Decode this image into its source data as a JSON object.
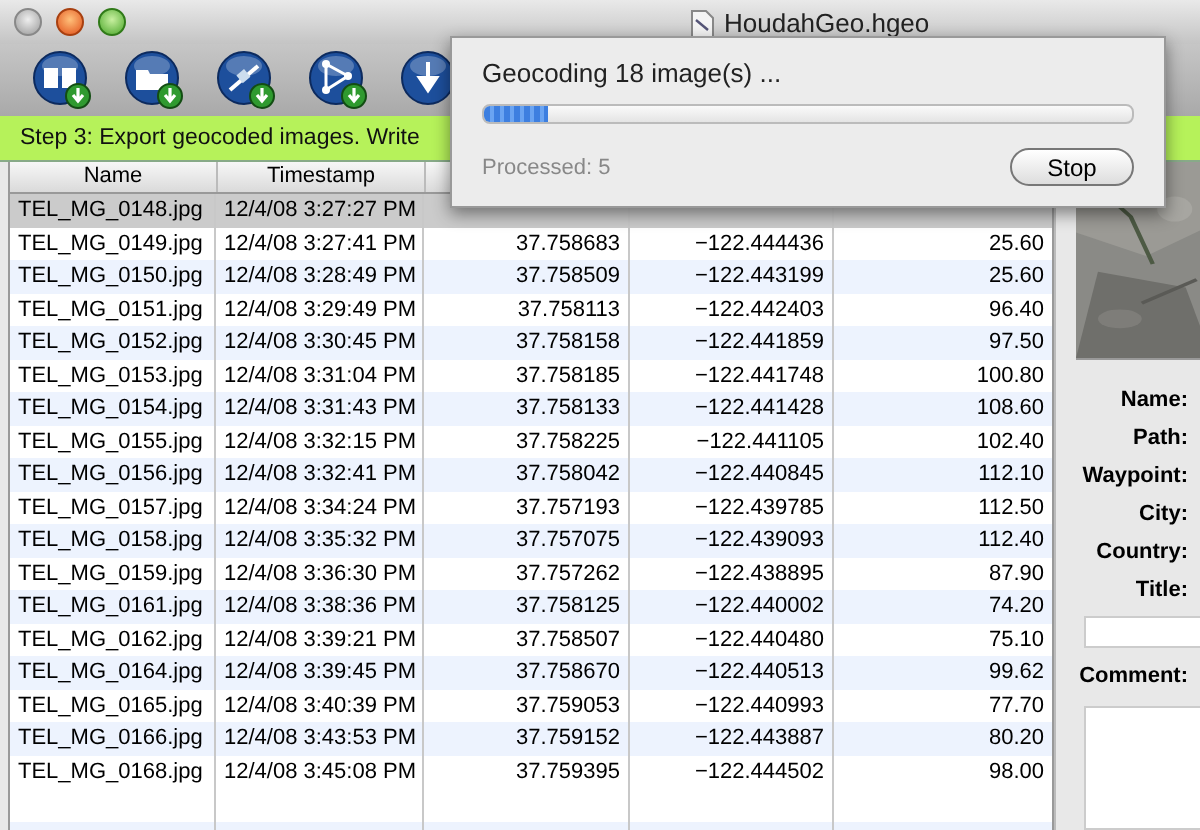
{
  "window": {
    "title": "HoudahGeo.hgeo"
  },
  "toolbar": {
    "buttons": [
      {
        "kind": "book"
      },
      {
        "kind": "folder"
      },
      {
        "kind": "satellite"
      },
      {
        "kind": "path"
      },
      {
        "kind": "arrow"
      }
    ]
  },
  "step_bar": {
    "text": "Step 3: Export geocoded images. Write"
  },
  "table": {
    "columns": [
      "Name",
      "Timestamp"
    ],
    "rows": [
      {
        "name": "TEL_MG_0148.jpg",
        "timestamp": "12/4/08 3:27:27 PM",
        "selected": true
      },
      {
        "name": "TEL_MG_0149.jpg",
        "timestamp": "12/4/08 3:27:41 PM",
        "latitude": "37.758683",
        "longitude": "−122.444436",
        "altitude": "25.60",
        "selected": false
      },
      {
        "name": "TEL_MG_0150.jpg",
        "timestamp": "12/4/08 3:28:49 PM",
        "latitude": "37.758509",
        "longitude": "−122.443199",
        "altitude": "25.60",
        "selected": false
      },
      {
        "name": "TEL_MG_0151.jpg",
        "timestamp": "12/4/08 3:29:49 PM",
        "latitude": "37.758113",
        "longitude": "−122.442403",
        "altitude": "96.40",
        "selected": false
      },
      {
        "name": "TEL_MG_0152.jpg",
        "timestamp": "12/4/08 3:30:45 PM",
        "latitude": "37.758158",
        "longitude": "−122.441859",
        "altitude": "97.50",
        "selected": false
      },
      {
        "name": "TEL_MG_0153.jpg",
        "timestamp": "12/4/08 3:31:04 PM",
        "latitude": "37.758185",
        "longitude": "−122.441748",
        "altitude": "100.80",
        "selected": false
      },
      {
        "name": "TEL_MG_0154.jpg",
        "timestamp": "12/4/08 3:31:43 PM",
        "latitude": "37.758133",
        "longitude": "−122.441428",
        "altitude": "108.60",
        "selected": false
      },
      {
        "name": "TEL_MG_0155.jpg",
        "timestamp": "12/4/08 3:32:15 PM",
        "latitude": "37.758225",
        "longitude": "−122.441105",
        "altitude": "102.40",
        "selected": false
      },
      {
        "name": "TEL_MG_0156.jpg",
        "timestamp": "12/4/08 3:32:41 PM",
        "latitude": "37.758042",
        "longitude": "−122.440845",
        "altitude": "112.10",
        "selected": false
      },
      {
        "name": "TEL_MG_0157.jpg",
        "timestamp": "12/4/08 3:34:24 PM",
        "latitude": "37.757193",
        "longitude": "−122.439785",
        "altitude": "112.50",
        "selected": false
      },
      {
        "name": "TEL_MG_0158.jpg",
        "timestamp": "12/4/08 3:35:32 PM",
        "latitude": "37.757075",
        "longitude": "−122.439093",
        "altitude": "112.40",
        "selected": false
      },
      {
        "name": "TEL_MG_0159.jpg",
        "timestamp": "12/4/08 3:36:30 PM",
        "latitude": "37.757262",
        "longitude": "−122.438895",
        "altitude": "87.90",
        "selected": false
      },
      {
        "name": "TEL_MG_0161.jpg",
        "timestamp": "12/4/08 3:38:36 PM",
        "latitude": "37.758125",
        "longitude": "−122.440002",
        "altitude": "74.20",
        "selected": false
      },
      {
        "name": "TEL_MG_0162.jpg",
        "timestamp": "12/4/08 3:39:21 PM",
        "latitude": "37.758507",
        "longitude": "−122.440480",
        "altitude": "75.10",
        "selected": false
      },
      {
        "name": "TEL_MG_0164.jpg",
        "timestamp": "12/4/08 3:39:45 PM",
        "latitude": "37.758670",
        "longitude": "−122.440513",
        "altitude": "99.62",
        "selected": false
      },
      {
        "name": "TEL_MG_0165.jpg",
        "timestamp": "12/4/08 3:40:39 PM",
        "latitude": "37.759053",
        "longitude": "−122.440993",
        "altitude": "77.70",
        "selected": false
      },
      {
        "name": "TEL_MG_0166.jpg",
        "timestamp": "12/4/08 3:43:53 PM",
        "latitude": "37.759152",
        "longitude": "−122.443887",
        "altitude": "80.20",
        "selected": false
      },
      {
        "name": "TEL_MG_0168.jpg",
        "timestamp": "12/4/08 3:45:08 PM",
        "latitude": "37.759395",
        "longitude": "−122.444502",
        "altitude": "98.00",
        "selected": false
      }
    ]
  },
  "details": {
    "fields": [
      {
        "label": "Name:",
        "kind": "text"
      },
      {
        "label": "Path:",
        "kind": "text"
      },
      {
        "label": "Waypoint:",
        "kind": "text"
      },
      {
        "label": "City:",
        "kind": "text"
      },
      {
        "label": "Country:",
        "kind": "text"
      },
      {
        "label": "Title:",
        "kind": "input"
      },
      {
        "label": "Comment:",
        "kind": "area"
      }
    ]
  },
  "progress_sheet": {
    "title": "Geocoding 18 image(s) ...",
    "level": 0.1,
    "status": "Processed: 5",
    "button": "Stop"
  }
}
